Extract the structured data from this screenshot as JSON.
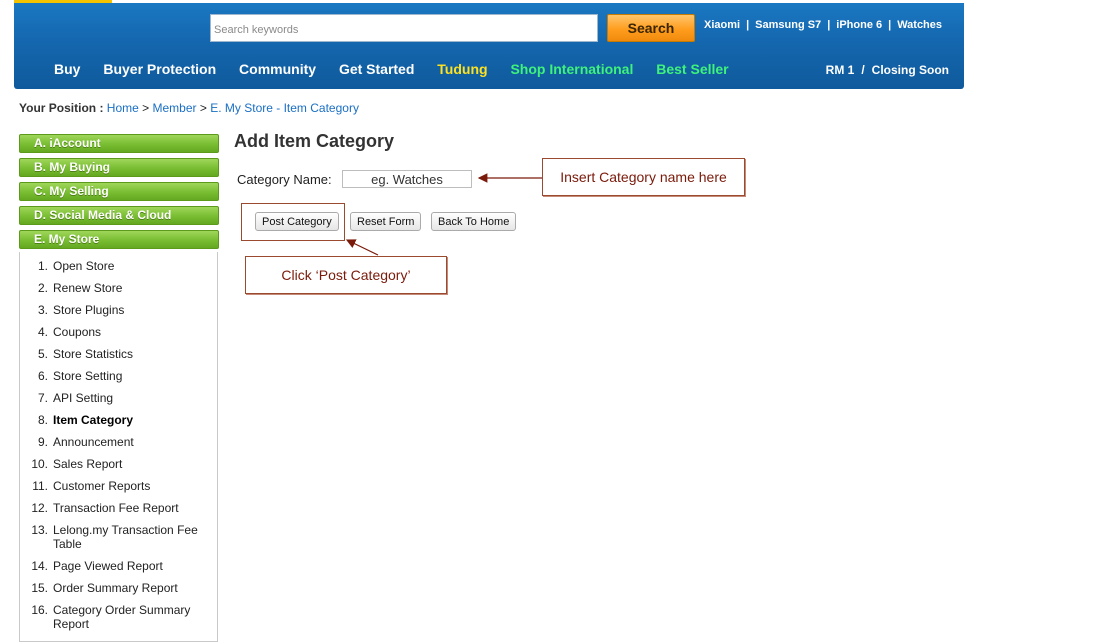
{
  "header": {
    "search_placeholder": "Search keywords",
    "search_button": "Search",
    "quick_links": [
      "Xiaomi",
      "Samsung S7",
      "iPhone 6",
      "Watches"
    ],
    "nav": [
      {
        "label": "Buy",
        "color": "#ffffff"
      },
      {
        "label": "Buyer Protection",
        "color": "#ffffff"
      },
      {
        "label": "Community",
        "color": "#ffffff"
      },
      {
        "label": "Get Started",
        "color": "#ffffff"
      },
      {
        "label": "Tudung",
        "color": "#ffe21f"
      },
      {
        "label": "Shop International",
        "color": "#3ef27a"
      },
      {
        "label": "Best Seller",
        "color": "#3ef27a"
      }
    ],
    "rm_label": "RM 1",
    "slash": "/",
    "closing_label": "Closing Soon"
  },
  "breadcrumb": {
    "prefix": "Your Position :",
    "items": [
      "Home",
      "Member",
      "E. My Store - Item Category"
    ],
    "separator": ">"
  },
  "sidebar": {
    "tabs": [
      "A. iAccount",
      "B. My Buying",
      "C. My Selling",
      "D. Social Media & Cloud",
      "E. My Store"
    ],
    "items": [
      {
        "num": "1.",
        "label": "Open Store"
      },
      {
        "num": "2.",
        "label": "Renew Store"
      },
      {
        "num": "3.",
        "label": "Store Plugins"
      },
      {
        "num": "4.",
        "label": "Coupons"
      },
      {
        "num": "5.",
        "label": "Store Statistics"
      },
      {
        "num": "6.",
        "label": "Store Setting"
      },
      {
        "num": "7.",
        "label": "API Setting"
      },
      {
        "num": "8.",
        "label": "Item Category"
      },
      {
        "num": "9.",
        "label": "Announcement"
      },
      {
        "num": "10.",
        "label": "Sales Report"
      },
      {
        "num": "11.",
        "label": "Customer Reports"
      },
      {
        "num": "12.",
        "label": "Transaction Fee Report"
      },
      {
        "num": "13.",
        "label": "Lelong.my Transaction Fee Table"
      },
      {
        "num": "14.",
        "label": "Page Viewed Report"
      },
      {
        "num": "15.",
        "label": "Order Summary Report"
      },
      {
        "num": "16.",
        "label": "Category Order Summary Report"
      }
    ],
    "active_item": "Item Category"
  },
  "main": {
    "title": "Add Item Category",
    "category_label": "Category Name:",
    "category_placeholder": "eg. Watches",
    "buttons": {
      "post": "Post Category",
      "reset": "Reset Form",
      "back": "Back To Home"
    }
  },
  "annotations": {
    "insert_note": "Insert Category name here",
    "click_note": "Click ‘Post Category’",
    "color": "#7a1a0a"
  }
}
